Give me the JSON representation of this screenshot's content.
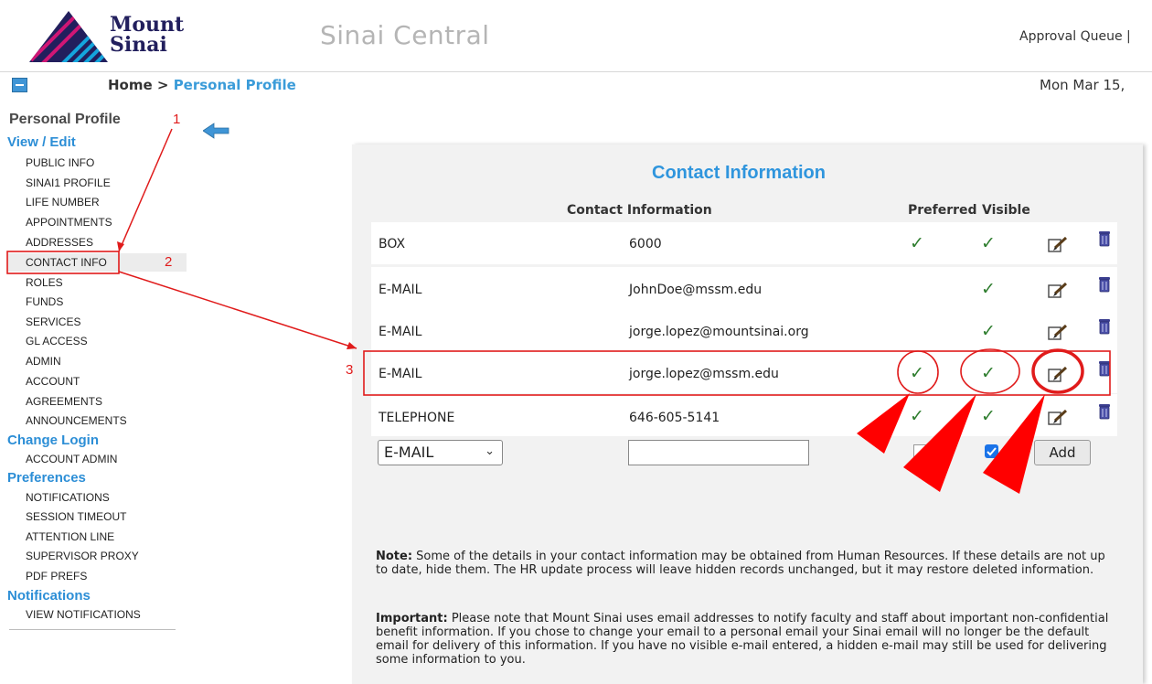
{
  "header": {
    "logo_line1": "Mount",
    "logo_line2": "Sinai",
    "app_title": "Sinai Central",
    "top_link": "Approval Queue |"
  },
  "breadcrumb": {
    "home": "Home",
    "separator": " > ",
    "current": "Personal Profile",
    "date": "Mon Mar 15,"
  },
  "sidebar": {
    "title": "Personal Profile",
    "sections": [
      {
        "label": "View / Edit",
        "items": [
          "PUBLIC INFO",
          "SINAI1 PROFILE",
          "LIFE NUMBER",
          "APPOINTMENTS",
          "ADDRESSES",
          "CONTACT INFO",
          "ROLES",
          "FUNDS",
          "SERVICES",
          "GL ACCESS",
          "ADMIN",
          "ACCOUNT",
          "AGREEMENTS",
          "ANNOUNCEMENTS"
        ]
      },
      {
        "label": "Change Login",
        "items": [
          "ACCOUNT ADMIN"
        ]
      },
      {
        "label": "Preferences",
        "items": [
          "NOTIFICATIONS",
          "SESSION TIMEOUT",
          "ATTENTION LINE",
          "SUPERVISOR PROXY",
          "PDF PREFS"
        ]
      },
      {
        "label": "Notifications",
        "items": [
          "VIEW NOTIFICATIONS"
        ]
      }
    ],
    "selected_item": "CONTACT INFO"
  },
  "contact": {
    "title": "Contact Information",
    "col_contact": "Contact Information",
    "col_preferred": "Preferred",
    "col_visible": "Visible",
    "rows": [
      {
        "type": "BOX",
        "value": "6000",
        "preferred": true,
        "visible": true
      },
      {
        "type": "E-MAIL",
        "value": "JohnDoe@mssm.edu",
        "preferred": false,
        "visible": true
      },
      {
        "type": "E-MAIL",
        "value": "jorge.lopez@mountsinai.org",
        "preferred": false,
        "visible": true
      },
      {
        "type": "E-MAIL",
        "value": "jorge.lopez@mssm.edu",
        "preferred": true,
        "visible": true
      },
      {
        "type": "TELEPHONE",
        "value": "646-605-5141",
        "preferred": true,
        "visible": true
      }
    ],
    "new_row": {
      "type_selected": "E-MAIL",
      "value": "",
      "preferred": false,
      "visible": true,
      "add_label": "Add"
    },
    "check_glyph": "✓"
  },
  "notes": {
    "note_label": "Note:",
    "note_text": " Some of the details in your contact information may be obtained from Human Resources. If these details are not up to date, hide them. The HR update process will leave hidden records unchanged, but it may restore deleted information.",
    "important_label": "Important:",
    "important_text": " Please note that Mount Sinai uses email addresses to notify faculty and staff about important non-confidential benefit information. If you chose to change your email to a personal email your Sinai email will no longer be the default email for delivery of this information. If you have no visible e-mail entered, a hidden e-mail may still be used for delivering some information to you."
  },
  "annotations": {
    "n1": "1",
    "n2": "2",
    "n3": "3"
  },
  "colors": {
    "accent_blue": "#2f95dd",
    "annotation_red": "#e01b1b",
    "check_green": "#2e7d2e"
  }
}
